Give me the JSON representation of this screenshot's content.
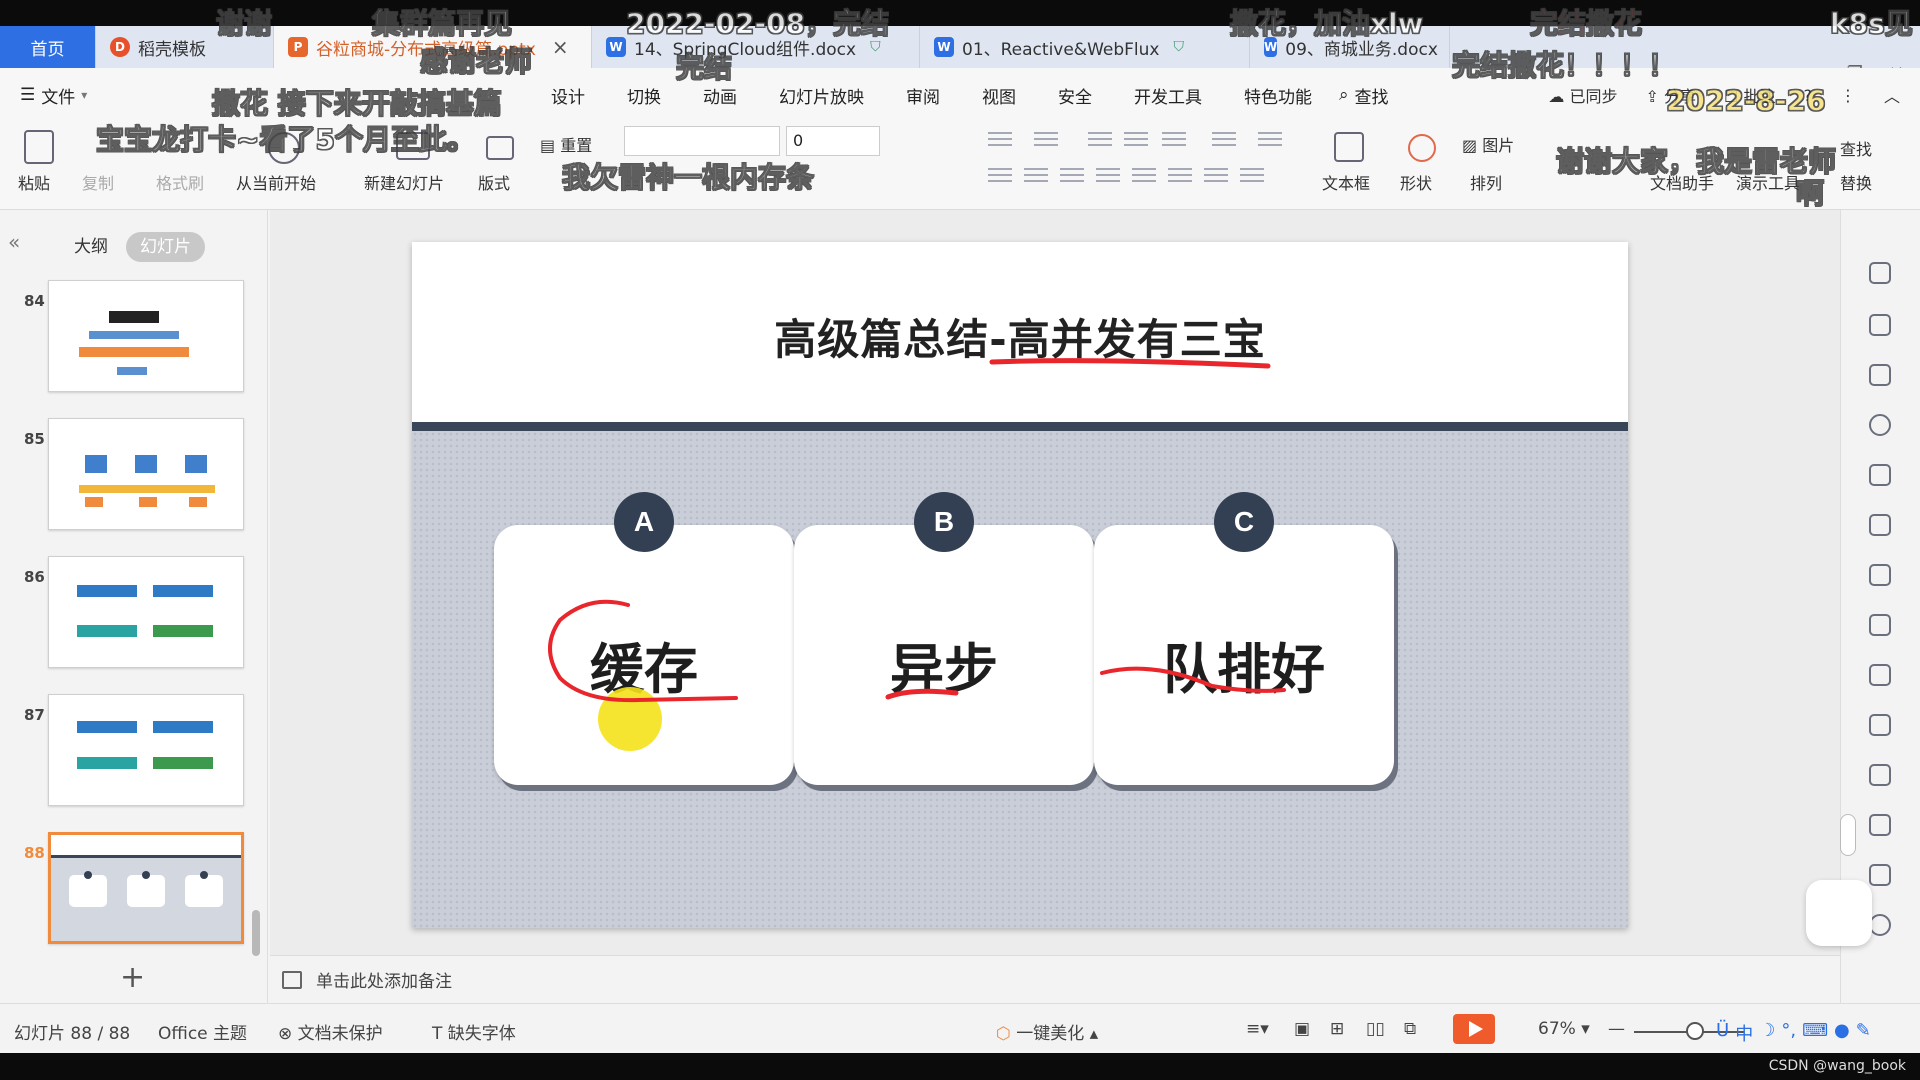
{
  "tabs": [
    {
      "label": "首页"
    },
    {
      "label": "稻壳模板"
    },
    {
      "label": "谷粒商城-分布式高级篇.pptx"
    },
    {
      "label": "14、SpringCloud组件.docx"
    },
    {
      "label": "01、Reactive&WebFlux"
    },
    {
      "label": "09、商城业务.docx"
    }
  ],
  "menu": {
    "file": "文件",
    "items": [
      "设计",
      "切换",
      "动画",
      "幻灯片放映",
      "审阅",
      "视图",
      "安全",
      "开发工具",
      "特色功能"
    ],
    "search": "查找",
    "synced": "已同步",
    "share": "分享",
    "annotate": "批注"
  },
  "toolbar": {
    "paste": "粘贴",
    "copy": "复制",
    "format_painter": "格式刷",
    "from_start": "从当前开始",
    "new_slide": "新建幻灯片",
    "layout": "版式",
    "reset": "重置",
    "font_size": "0",
    "textbox": "文本框",
    "shape": "形状",
    "arrange": "排列",
    "picture": "图片",
    "doc_assistant": "文档助手",
    "present_tools": "演示工具",
    "find": "查找",
    "replace": "替换"
  },
  "left_panel": {
    "tab_outline": "大纲",
    "tab_slides": "幻灯片",
    "thumbnails": [
      {
        "num": "84"
      },
      {
        "num": "85"
      },
      {
        "num": "86"
      },
      {
        "num": "87"
      },
      {
        "num": "88",
        "selected": true,
        "items": [
          "缓存",
          "异步",
          "队排好"
        ]
      }
    ]
  },
  "slide": {
    "title": "高级篇总结-高并发有三宝",
    "cards": [
      {
        "badge": "A",
        "text": "缓存"
      },
      {
        "badge": "B",
        "text": "异步"
      },
      {
        "badge": "C",
        "text": "队排好"
      }
    ]
  },
  "notes_placeholder": "单击此处添加备注",
  "status": {
    "slide_count": "幻灯片 88 / 88",
    "theme": "Office 主题",
    "protect": "文档未保护",
    "missing_font": "缺失字体",
    "beautify": "一键美化",
    "zoom": "67%"
  },
  "ime": {
    "lang": "中"
  },
  "watermark": "CSDN @wang_book",
  "danmaku": [
    "谢谢",
    "集群篇再见",
    "2022-02-08，完结",
    "撒花，加油xlw",
    "完结撒花",
    "k8s见",
    "感谢老师",
    "完结",
    "完结撒花！！！！",
    "2022-8-26",
    "撒花 接下来开敲搞基篇",
    "宝宝龙打卡~看了5个月至此。",
    "我欠雷神一根内存条",
    "谢谢大家，我是雷老师",
    "啊"
  ],
  "colors": {
    "accent_blue": "#2f6fe4",
    "active_tab_orange": "#d4612a",
    "selection_orange": "#f08a3c",
    "slide_dark": "#333f52",
    "annotation_red": "#e8262b",
    "highlighter_yellow": "#f4e21a"
  }
}
